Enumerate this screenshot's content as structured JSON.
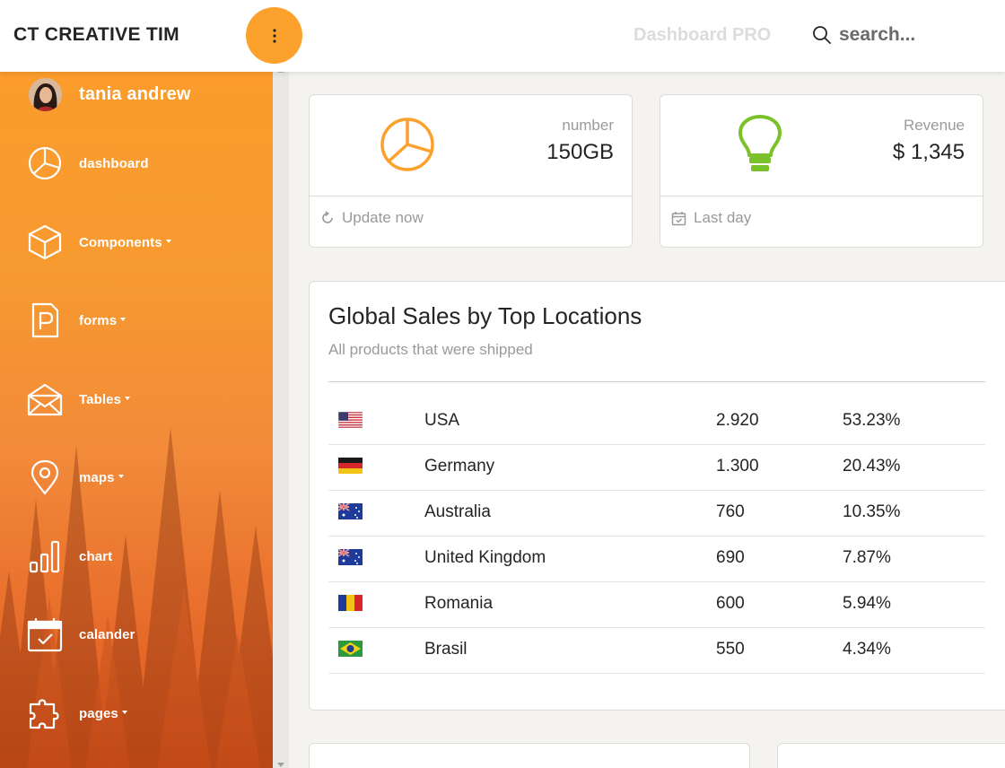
{
  "topbar": {
    "brand": "CT CREATIVE TIM",
    "menu_icon": "dots-vertical-icon",
    "title": "Dashboard PRO",
    "search_placeholder": "search..."
  },
  "sidebar": {
    "user": {
      "name": "tania andrew"
    },
    "items": [
      {
        "label": "dashboard",
        "icon": "pie-chart-icon",
        "has_caret": false
      },
      {
        "label": "Components",
        "icon": "box-icon",
        "has_caret": true
      },
      {
        "label": "forms",
        "icon": "form-doc-icon",
        "has_caret": true
      },
      {
        "label": "Tables",
        "icon": "envelope-icon",
        "has_caret": true
      },
      {
        "label": "maps",
        "icon": "map-pin-icon",
        "has_caret": true
      },
      {
        "label": "chart",
        "icon": "bar-chart-icon",
        "has_caret": false
      },
      {
        "label": "calander",
        "icon": "calendar-check-icon",
        "has_caret": false
      },
      {
        "label": "pages",
        "icon": "puzzle-icon",
        "has_caret": true
      }
    ]
  },
  "stats": [
    {
      "label": "number",
      "value": "150GB",
      "footer": "Update now",
      "icon": "pie-chart-icon",
      "footer_icon": "refresh-icon",
      "color": "#fba12c"
    },
    {
      "label": "Revenue",
      "value": "$ 1,345",
      "footer": "Last day",
      "icon": "lightbulb-icon",
      "footer_icon": "calendar-icon",
      "color": "#7ac12a"
    }
  ],
  "sales": {
    "title": "Global Sales by Top Locations",
    "subtitle": "All products that were shipped",
    "rows": [
      {
        "flag": "us-flag",
        "country": "USA",
        "amount": "2.920",
        "percent": "53.23%"
      },
      {
        "flag": "de-flag",
        "country": "Germany",
        "amount": "1.300",
        "percent": "20.43%"
      },
      {
        "flag": "au-flag",
        "country": "Australia",
        "amount": "760",
        "percent": "10.35%"
      },
      {
        "flag": "au-flag",
        "country": "United Kingdom",
        "amount": "690",
        "percent": "7.87%"
      },
      {
        "flag": "ro-flag",
        "country": "Romania",
        "amount": "600",
        "percent": "5.94%"
      },
      {
        "flag": "br-flag",
        "country": "Brasil",
        "amount": "550",
        "percent": "4.34%"
      }
    ]
  },
  "colors": {
    "accent": "#fba12c",
    "success": "#7ac12a",
    "muted_text": "#9a9a9a"
  }
}
